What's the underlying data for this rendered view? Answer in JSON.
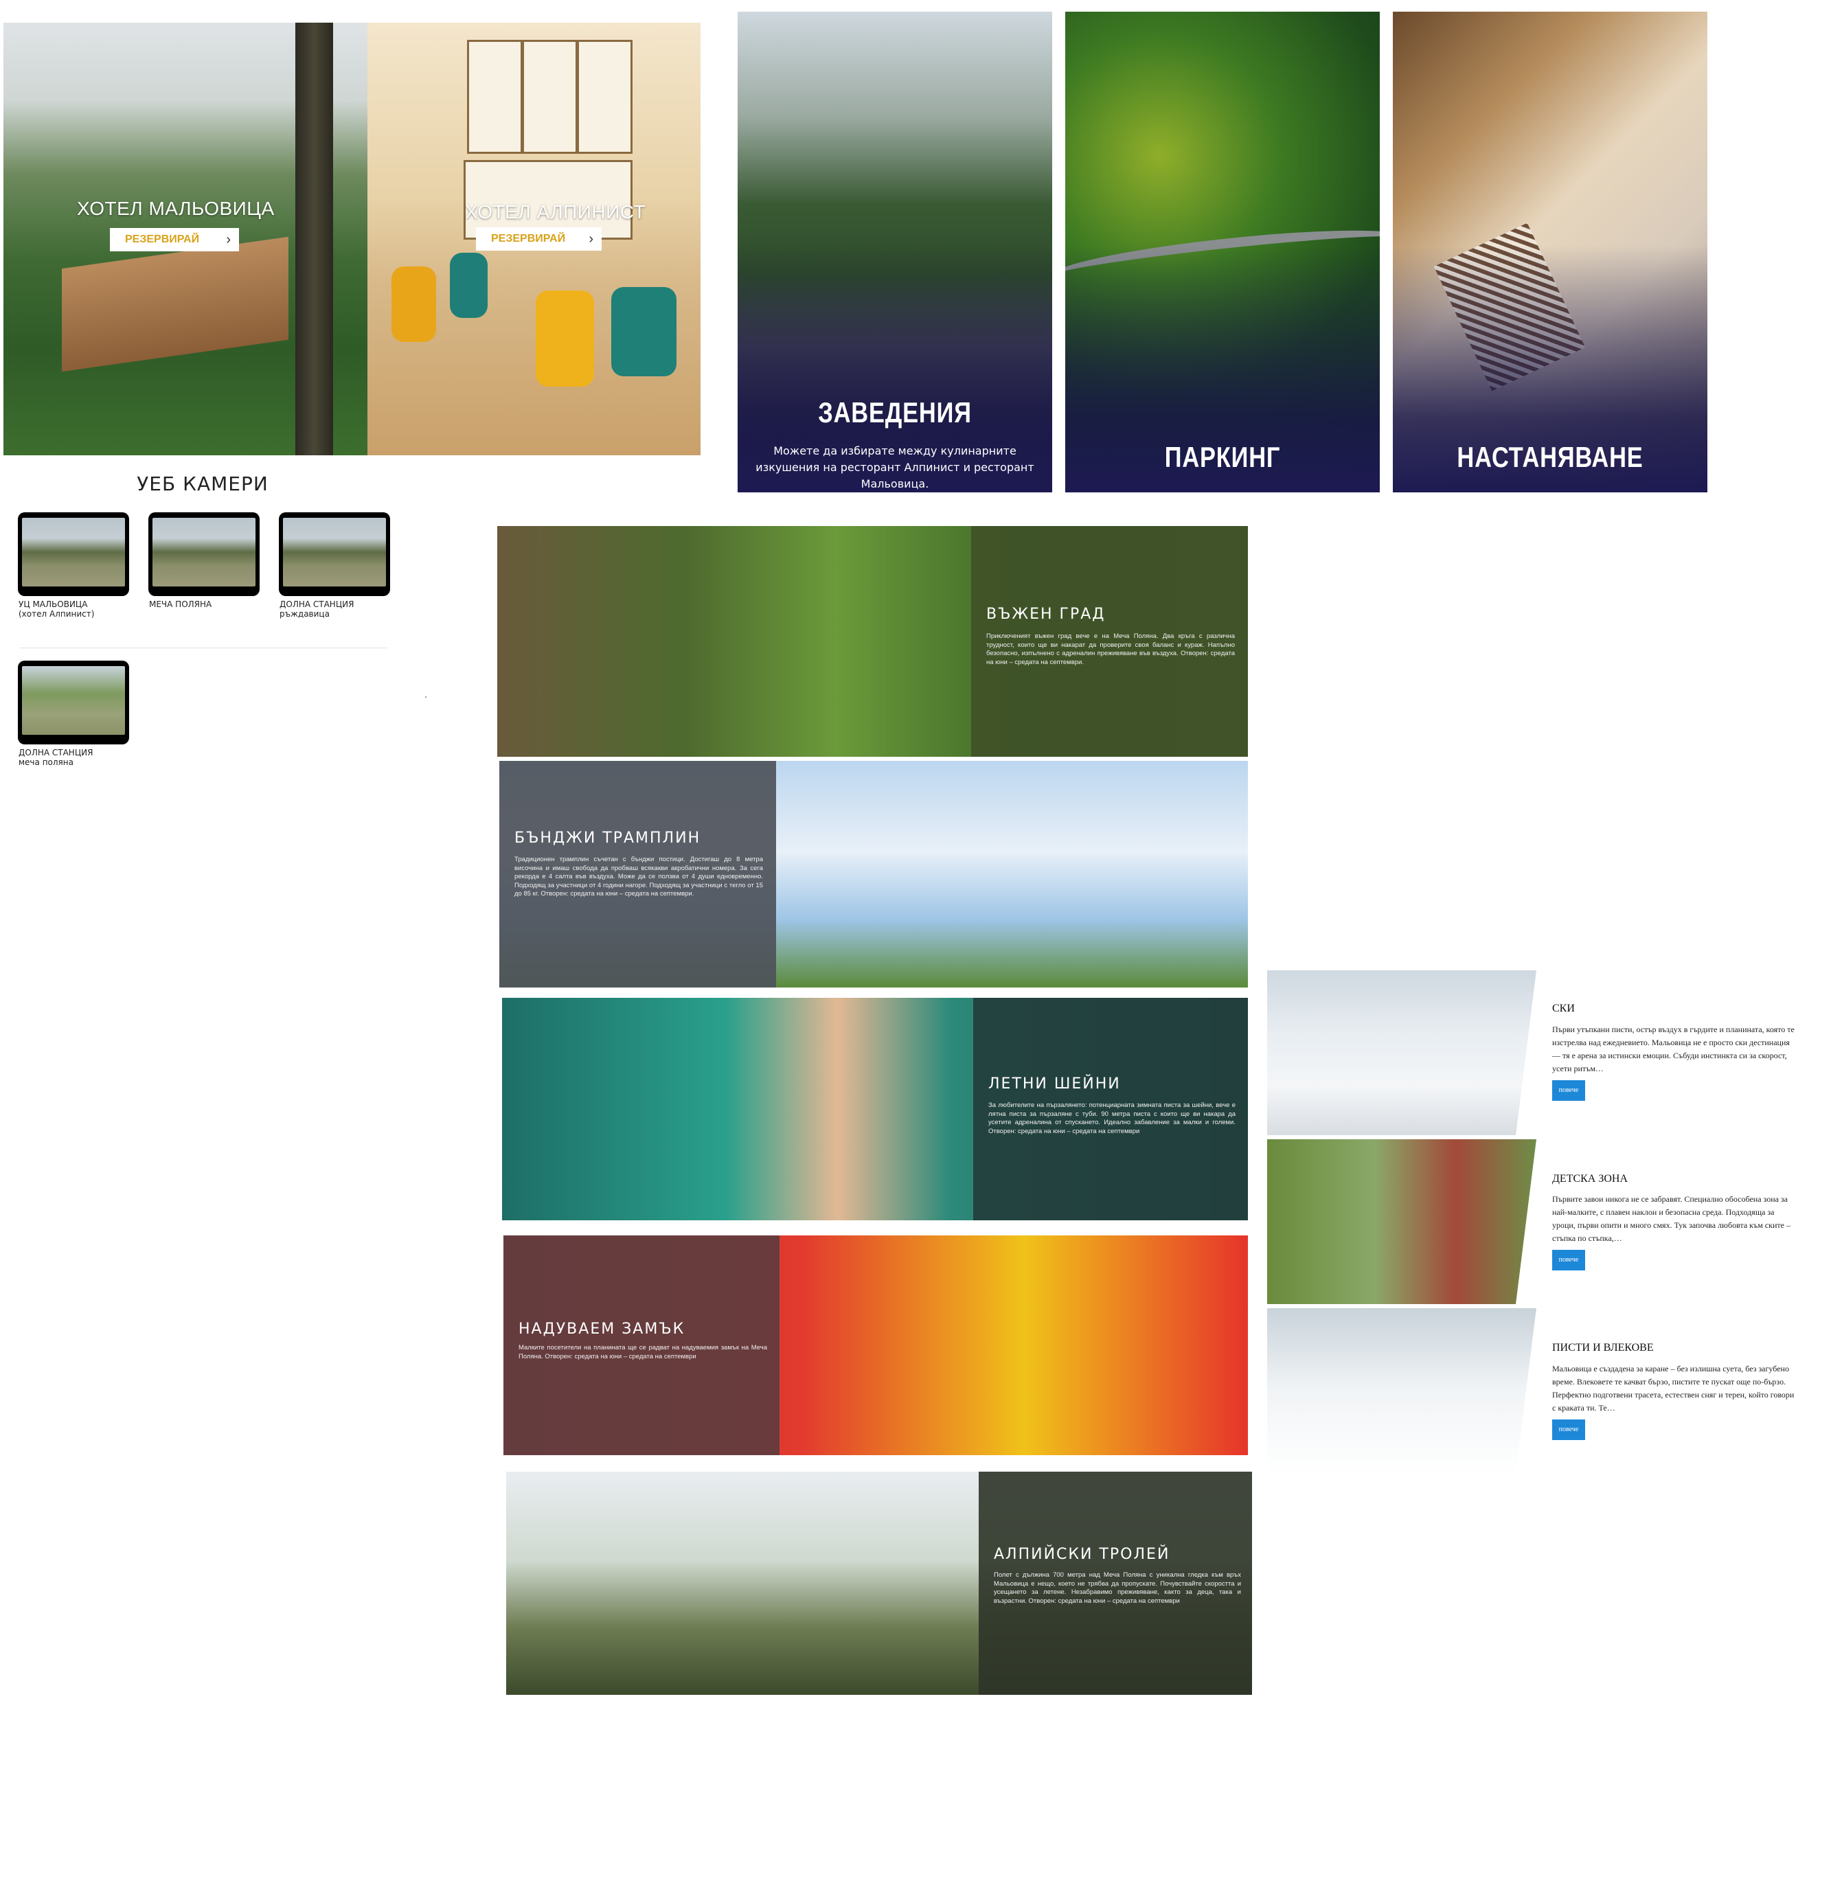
{
  "hotels": [
    {
      "title": "ХОТЕЛ МАЛЬОВИЦА",
      "button": "РЕЗЕРВИРАЙ"
    },
    {
      "title": "ХОТЕЛ АЛПИНИСТ",
      "button": "РЕЗЕРВИРАЙ"
    }
  ],
  "features": [
    {
      "title": "ЗАВЕДЕНИЯ",
      "text": "Можете да избирате между кулинарните изкушения на ресторант Алпинист и ресторант Мальовица."
    },
    {
      "title": "ПАРКИНГ",
      "text": ""
    },
    {
      "title": "НАСТАНЯВАНЕ",
      "text": ""
    }
  ],
  "webcams": {
    "title": "УЕБ КАМЕРИ",
    "items": [
      {
        "line1": "УЦ МАЛЬОВИЦА",
        "line2": "(хотел Алпинист)"
      },
      {
        "line1": "МЕЧА ПОЛЯНА",
        "line2": ""
      },
      {
        "line1": "ДОЛНА СТАНЦИЯ",
        "line2": "ръждавица"
      },
      {
        "line1": "ДОЛНА СТАНЦИЯ",
        "line2": "меча поляна"
      }
    ]
  },
  "activities": [
    {
      "title": "ВЪЖЕН ГРАД",
      "text": "Приключеният въжен град вече е на Меча Поляна. Два кръга с различна трудност, които ще ви накарат да проверите своя баланс и кураж. Напълно безопасно, изпълнено с адреналин преживяване във въздуха. Отворен: средата на юни – средата на септември."
    },
    {
      "title": "БЪНДЖИ ТРАМПЛИН",
      "text": "Традиционен трамплин съчетан с бънджи постици. Достигаш до 8 метра височина и имаш свобода да пробваш всякакви акробатични номера. За сега рекорда е 4 салта във въздуха. Може да се ползва от 4 души едновременно. Подходящ за участници от 4 години нагоре. Подходящ за участници с тегло от 15 до 85 кг. Отворен: средата на юни – средата на септември."
    },
    {
      "title": "ЛЕТНИ ШЕЙНИ",
      "text": "За любителите на пързалянето: потенциарната зимната писта за шейни, вече е лятна писта за пързаляне с туби. 90 метра писта с които ще ви накара да усетите адреналина от спускането. Идеално забавление за малки и големи. Отворен: средата на юни – средата на септември"
    },
    {
      "title": "НАДУВАЕМ ЗАМЪК",
      "text": "Малките посетители на планината ще се радват на надуваемия замък на Меча Поляна. Отворен: средата на юни – средата на септември"
    },
    {
      "title": "АЛПИЙСКИ ТРОЛЕЙ",
      "text": "Полет с дължина 700 метра над Меча Поляна с уникална гледка към връх Мальовица е нещо, което не трябва да пропускате. Почувствайте скоростта и усещането за летене. Незабравимо преживяване, както за деца, така и възрастни. Отворен: средата на юни – средата на септември"
    }
  ],
  "side": [
    {
      "title": "СКИ",
      "text": "Първи утъпкани писти, остър въздух в гърдите и планината, която те изстрелва над ежедневието. Мальовица не е просто ски дестинация — тя е арена за истински емоции. Събуди инстинкта си за скорост, усети ритъм…",
      "button": "повече"
    },
    {
      "title": "ДЕТСКА ЗОНА",
      "text": "Първите завои никога не се забравят. Специално обособена зона за най-малките, с плавен наклон и безопасна среда. Подходяща за уроци, първи опити и много смях. Тук започва любовта към ските – стъпка по стъпка,…",
      "button": "повече"
    },
    {
      "title": "ПИСТИ И ВЛЕКОВЕ",
      "text": "Мальовица е създадена за каране – без излишна суета, без загубено време. Влековете те качват бързо, пистите те пускат още по-бързо. Перфектно подготвени трасета, естествен сняг и терен, който говори с краката ти. Те…",
      "button": "повече"
    }
  ]
}
